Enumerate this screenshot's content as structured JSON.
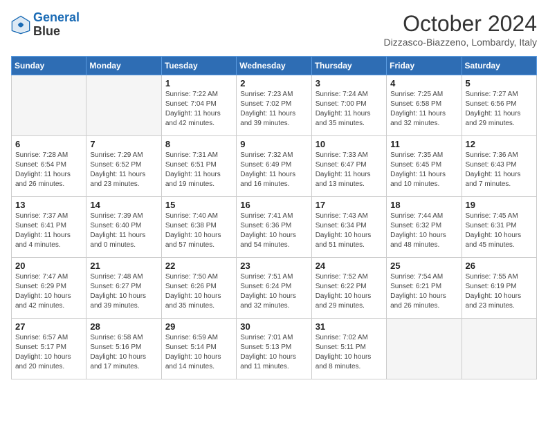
{
  "header": {
    "logo_line1": "General",
    "logo_line2": "Blue",
    "month_title": "October 2024",
    "location": "Dizzasco-Biazzeno, Lombardy, Italy"
  },
  "days_of_week": [
    "Sunday",
    "Monday",
    "Tuesday",
    "Wednesday",
    "Thursday",
    "Friday",
    "Saturday"
  ],
  "weeks": [
    [
      {
        "day": "",
        "empty": true
      },
      {
        "day": "",
        "empty": true
      },
      {
        "day": "1",
        "sunrise": "7:22 AM",
        "sunset": "7:04 PM",
        "daylight": "11 hours and 42 minutes."
      },
      {
        "day": "2",
        "sunrise": "7:23 AM",
        "sunset": "7:02 PM",
        "daylight": "11 hours and 39 minutes."
      },
      {
        "day": "3",
        "sunrise": "7:24 AM",
        "sunset": "7:00 PM",
        "daylight": "11 hours and 35 minutes."
      },
      {
        "day": "4",
        "sunrise": "7:25 AM",
        "sunset": "6:58 PM",
        "daylight": "11 hours and 32 minutes."
      },
      {
        "day": "5",
        "sunrise": "7:27 AM",
        "sunset": "6:56 PM",
        "daylight": "11 hours and 29 minutes."
      }
    ],
    [
      {
        "day": "6",
        "sunrise": "7:28 AM",
        "sunset": "6:54 PM",
        "daylight": "11 hours and 26 minutes."
      },
      {
        "day": "7",
        "sunrise": "7:29 AM",
        "sunset": "6:52 PM",
        "daylight": "11 hours and 23 minutes."
      },
      {
        "day": "8",
        "sunrise": "7:31 AM",
        "sunset": "6:51 PM",
        "daylight": "11 hours and 19 minutes."
      },
      {
        "day": "9",
        "sunrise": "7:32 AM",
        "sunset": "6:49 PM",
        "daylight": "11 hours and 16 minutes."
      },
      {
        "day": "10",
        "sunrise": "7:33 AM",
        "sunset": "6:47 PM",
        "daylight": "11 hours and 13 minutes."
      },
      {
        "day": "11",
        "sunrise": "7:35 AM",
        "sunset": "6:45 PM",
        "daylight": "11 hours and 10 minutes."
      },
      {
        "day": "12",
        "sunrise": "7:36 AM",
        "sunset": "6:43 PM",
        "daylight": "11 hours and 7 minutes."
      }
    ],
    [
      {
        "day": "13",
        "sunrise": "7:37 AM",
        "sunset": "6:41 PM",
        "daylight": "11 hours and 4 minutes."
      },
      {
        "day": "14",
        "sunrise": "7:39 AM",
        "sunset": "6:40 PM",
        "daylight": "11 hours and 0 minutes."
      },
      {
        "day": "15",
        "sunrise": "7:40 AM",
        "sunset": "6:38 PM",
        "daylight": "10 hours and 57 minutes."
      },
      {
        "day": "16",
        "sunrise": "7:41 AM",
        "sunset": "6:36 PM",
        "daylight": "10 hours and 54 minutes."
      },
      {
        "day": "17",
        "sunrise": "7:43 AM",
        "sunset": "6:34 PM",
        "daylight": "10 hours and 51 minutes."
      },
      {
        "day": "18",
        "sunrise": "7:44 AM",
        "sunset": "6:32 PM",
        "daylight": "10 hours and 48 minutes."
      },
      {
        "day": "19",
        "sunrise": "7:45 AM",
        "sunset": "6:31 PM",
        "daylight": "10 hours and 45 minutes."
      }
    ],
    [
      {
        "day": "20",
        "sunrise": "7:47 AM",
        "sunset": "6:29 PM",
        "daylight": "10 hours and 42 minutes."
      },
      {
        "day": "21",
        "sunrise": "7:48 AM",
        "sunset": "6:27 PM",
        "daylight": "10 hours and 39 minutes."
      },
      {
        "day": "22",
        "sunrise": "7:50 AM",
        "sunset": "6:26 PM",
        "daylight": "10 hours and 35 minutes."
      },
      {
        "day": "23",
        "sunrise": "7:51 AM",
        "sunset": "6:24 PM",
        "daylight": "10 hours and 32 minutes."
      },
      {
        "day": "24",
        "sunrise": "7:52 AM",
        "sunset": "6:22 PM",
        "daylight": "10 hours and 29 minutes."
      },
      {
        "day": "25",
        "sunrise": "7:54 AM",
        "sunset": "6:21 PM",
        "daylight": "10 hours and 26 minutes."
      },
      {
        "day": "26",
        "sunrise": "7:55 AM",
        "sunset": "6:19 PM",
        "daylight": "10 hours and 23 minutes."
      }
    ],
    [
      {
        "day": "27",
        "sunrise": "6:57 AM",
        "sunset": "5:17 PM",
        "daylight": "10 hours and 20 minutes."
      },
      {
        "day": "28",
        "sunrise": "6:58 AM",
        "sunset": "5:16 PM",
        "daylight": "10 hours and 17 minutes."
      },
      {
        "day": "29",
        "sunrise": "6:59 AM",
        "sunset": "5:14 PM",
        "daylight": "10 hours and 14 minutes."
      },
      {
        "day": "30",
        "sunrise": "7:01 AM",
        "sunset": "5:13 PM",
        "daylight": "10 hours and 11 minutes."
      },
      {
        "day": "31",
        "sunrise": "7:02 AM",
        "sunset": "5:11 PM",
        "daylight": "10 hours and 8 minutes."
      },
      {
        "day": "",
        "empty": true
      },
      {
        "day": "",
        "empty": true
      }
    ]
  ]
}
